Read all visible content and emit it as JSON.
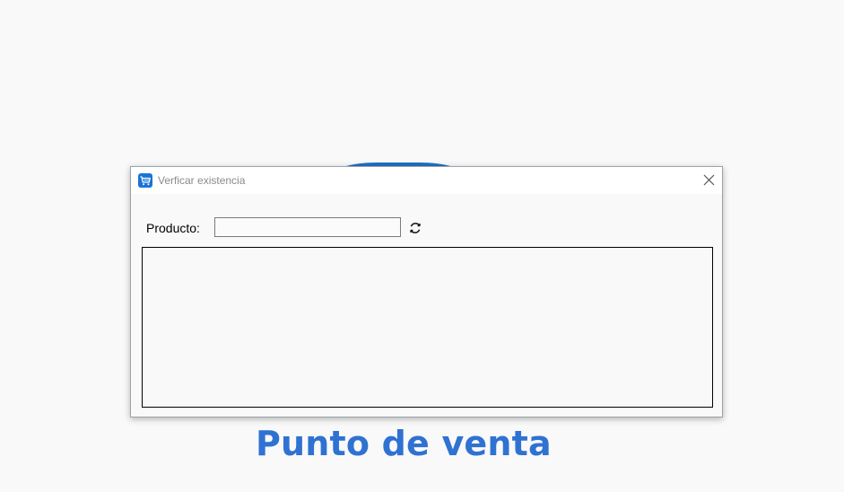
{
  "background": {
    "brand_text": "Punto de venta",
    "brand_color": "#2f72d2",
    "blob_color": "#1f6fc4"
  },
  "dialog": {
    "title": "Verficar existencia",
    "app_icon": "shopping-cart-icon",
    "close_icon": "close-icon",
    "product_label": "Producto:",
    "product_input_value": "",
    "refresh_icon": "refresh-icon",
    "results": []
  }
}
